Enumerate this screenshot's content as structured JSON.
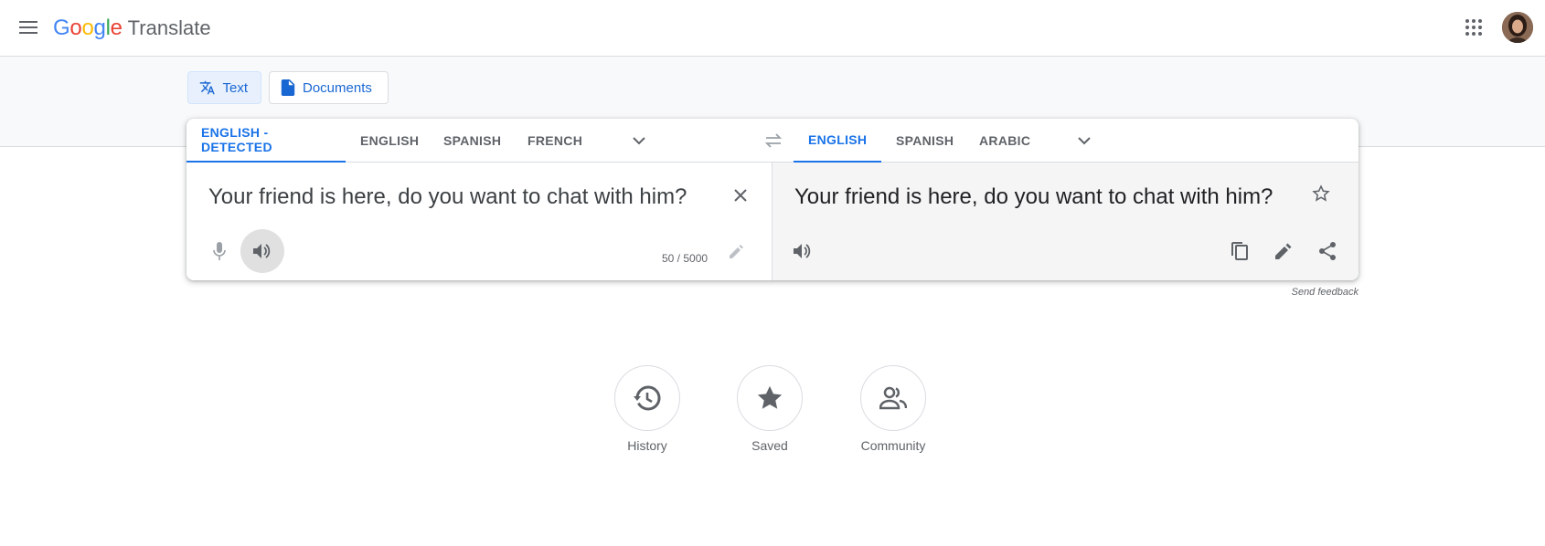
{
  "header": {
    "logo": {
      "letters": [
        "G",
        "o",
        "o",
        "g",
        "l",
        "e"
      ],
      "product": "Translate"
    }
  },
  "modes": [
    {
      "label": "Text",
      "icon": "translate-icon",
      "active": true
    },
    {
      "label": "Documents",
      "icon": "document-icon",
      "active": false
    }
  ],
  "source_langs": [
    {
      "label": "ENGLISH - DETECTED",
      "active": true
    },
    {
      "label": "ENGLISH",
      "active": false
    },
    {
      "label": "SPANISH",
      "active": false
    },
    {
      "label": "FRENCH",
      "active": false
    }
  ],
  "target_langs": [
    {
      "label": "ENGLISH",
      "active": true
    },
    {
      "label": "SPANISH",
      "active": false
    },
    {
      "label": "ARABIC",
      "active": false
    }
  ],
  "source": {
    "text": "Your friend is here, do you want to chat with him?",
    "char_count": "50 / 5000"
  },
  "target": {
    "text": "Your friend is here, do you want to chat with him?"
  },
  "feedback": "Send feedback",
  "shortcuts": [
    {
      "label": "History",
      "icon": "history-icon"
    },
    {
      "label": "Saved",
      "icon": "star-icon"
    },
    {
      "label": "Community",
      "icon": "community-icon"
    }
  ],
  "colors": {
    "accent": "#1a73e8",
    "target_bg": "#f5f5f5",
    "header_border": "#dadce0"
  }
}
